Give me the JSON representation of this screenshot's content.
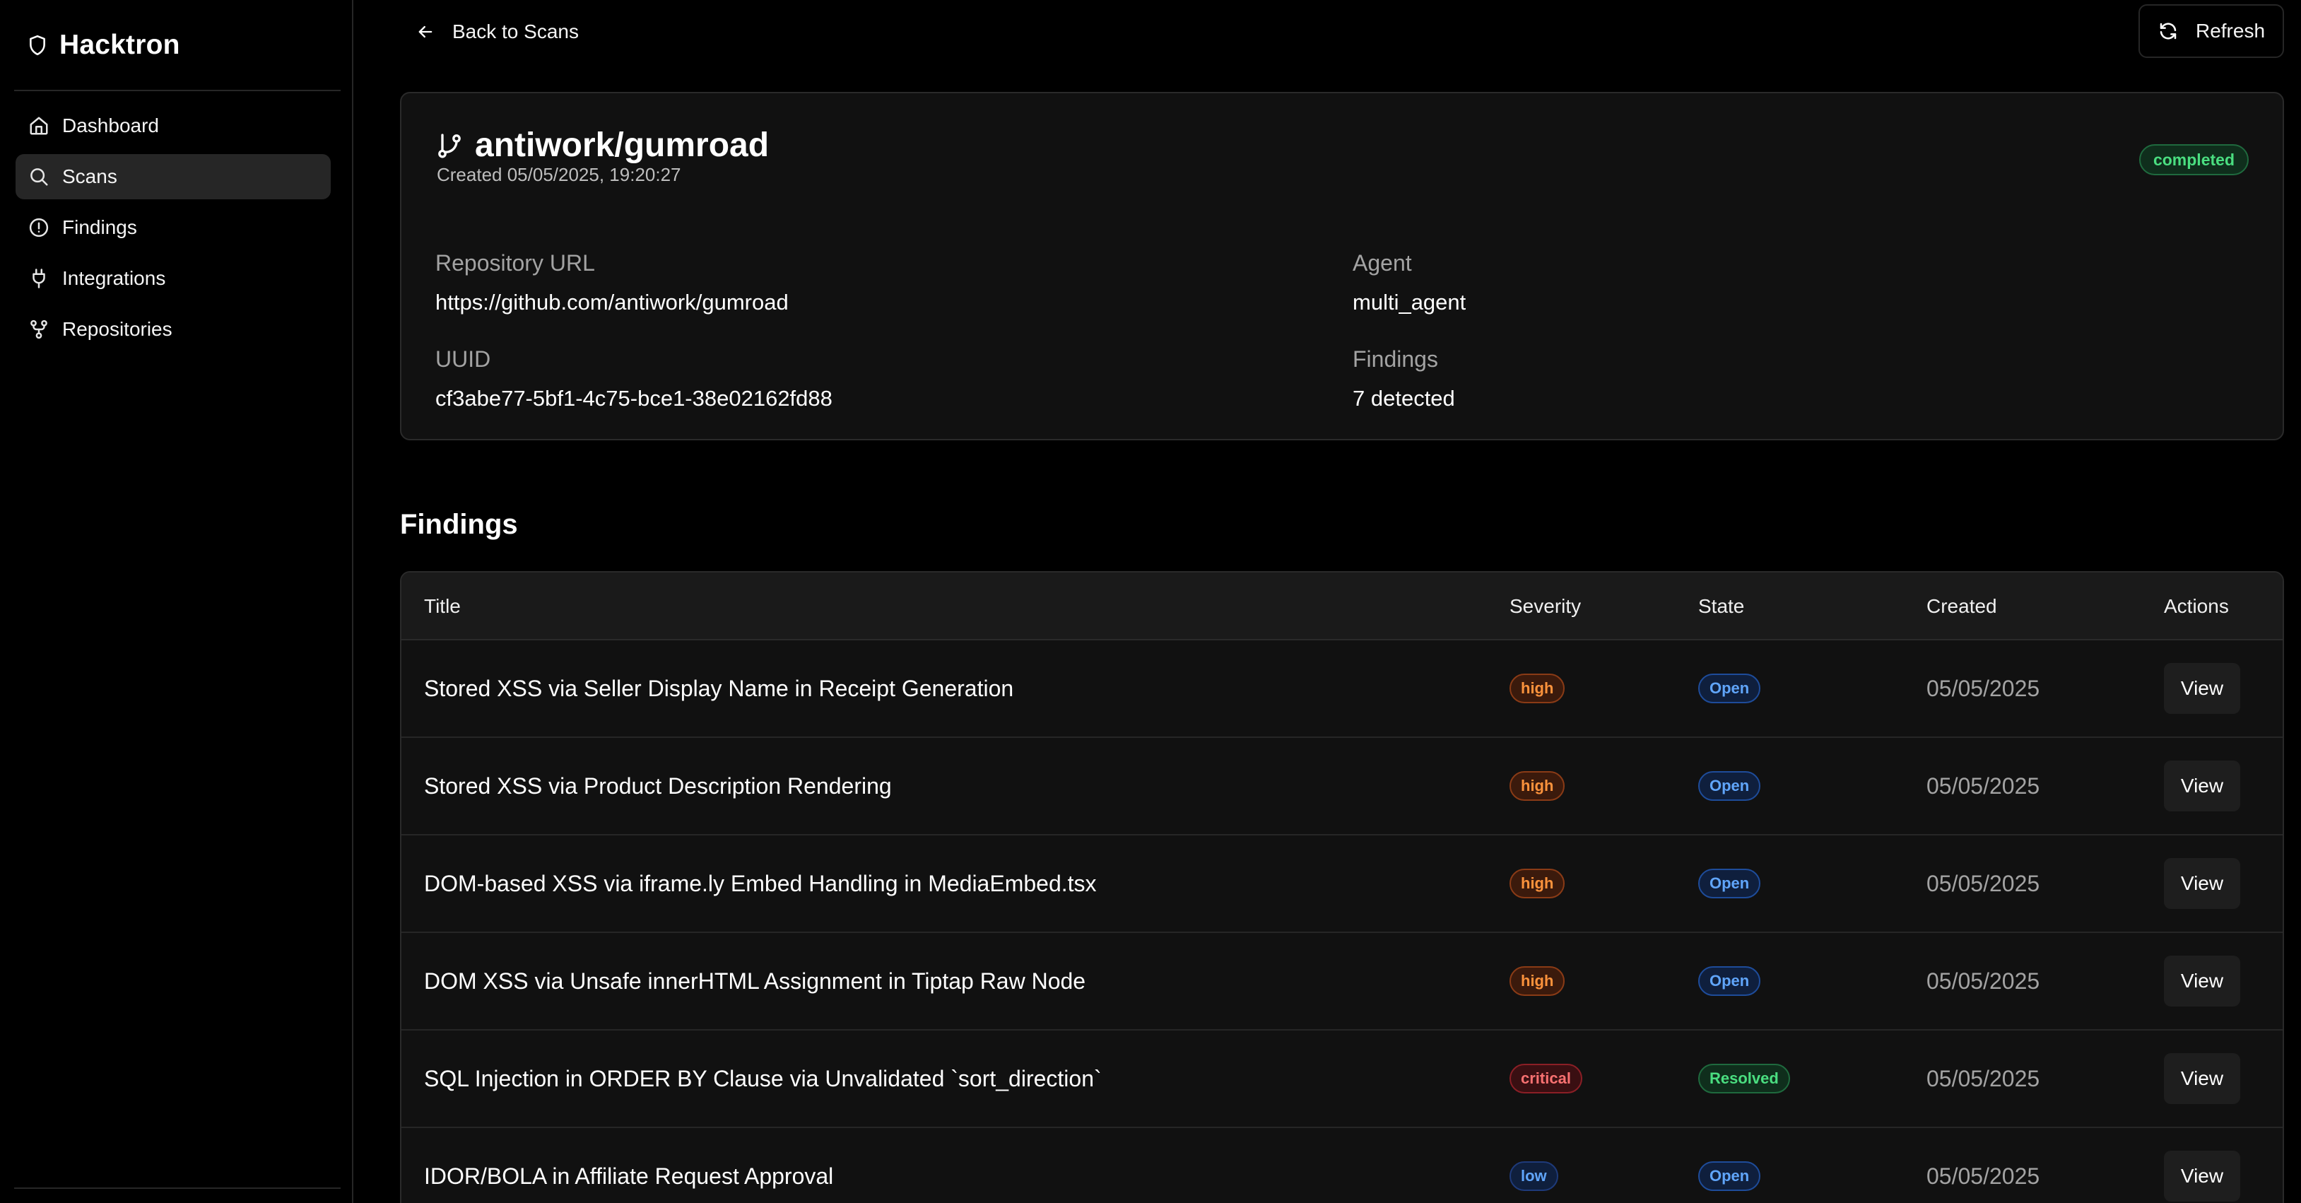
{
  "app": {
    "name": "Hacktron"
  },
  "sidebar": {
    "items": [
      {
        "label": "Dashboard",
        "icon": "home-icon",
        "active": false
      },
      {
        "label": "Scans",
        "icon": "search-icon",
        "active": true
      },
      {
        "label": "Findings",
        "icon": "alert-circle-icon",
        "active": false
      },
      {
        "label": "Integrations",
        "icon": "plug-icon",
        "active": false
      },
      {
        "label": "Repositories",
        "icon": "git-fork-icon",
        "active": false
      }
    ]
  },
  "header": {
    "back_label": "Back to Scans",
    "refresh_label": "Refresh"
  },
  "scan": {
    "repo_name": "antiwork/gumroad",
    "created": "Created 05/05/2025, 19:20:27",
    "status": "completed",
    "repo_url_label": "Repository URL",
    "repo_url": "https://github.com/antiwork/gumroad",
    "agent_label": "Agent",
    "agent": "multi_agent",
    "uuid_label": "UUID",
    "uuid": "cf3abe77-5bf1-4c75-bce1-38e02162fd88",
    "findings_label": "Findings",
    "findings_count": "7 detected"
  },
  "findings": {
    "section_title": "Findings",
    "columns": {
      "title": "Title",
      "severity": "Severity",
      "state": "State",
      "created": "Created",
      "actions": "Actions"
    },
    "rows": [
      {
        "title": "Stored XSS via Seller Display Name in Receipt Generation",
        "severity": "high",
        "state": "Open",
        "created": "05/05/2025",
        "action": "View"
      },
      {
        "title": "Stored XSS via Product Description Rendering",
        "severity": "high",
        "state": "Open",
        "created": "05/05/2025",
        "action": "View"
      },
      {
        "title": "DOM-based XSS via iframe.ly Embed Handling in MediaEmbed.tsx",
        "severity": "high",
        "state": "Open",
        "created": "05/05/2025",
        "action": "View"
      },
      {
        "title": "DOM XSS via Unsafe innerHTML Assignment in Tiptap Raw Node",
        "severity": "high",
        "state": "Open",
        "created": "05/05/2025",
        "action": "View"
      },
      {
        "title": "SQL Injection in ORDER BY Clause via Unvalidated `sort_direction`",
        "severity": "critical",
        "state": "Resolved",
        "created": "05/05/2025",
        "action": "View"
      },
      {
        "title": "IDOR/BOLA in Affiliate Request Approval",
        "severity": "low",
        "state": "Open",
        "created": "05/05/2025",
        "action": "View"
      }
    ]
  },
  "colors": {
    "high": {
      "bg": "#3b1a0c",
      "border": "#8a3b16",
      "text": "#fb923c"
    },
    "critical": {
      "bg": "#3a0f12",
      "border": "#8b1f26",
      "text": "#f87171"
    },
    "low": {
      "bg": "#0f1f3d",
      "border": "#1e3a7a",
      "text": "#60a5fa"
    },
    "Open": {
      "bg": "#0f1f3d",
      "border": "#1e4c9a",
      "text": "#60a5fa"
    },
    "Resolved": {
      "bg": "#0f2e1c",
      "border": "#1f6a3e",
      "text": "#4ade80"
    }
  }
}
